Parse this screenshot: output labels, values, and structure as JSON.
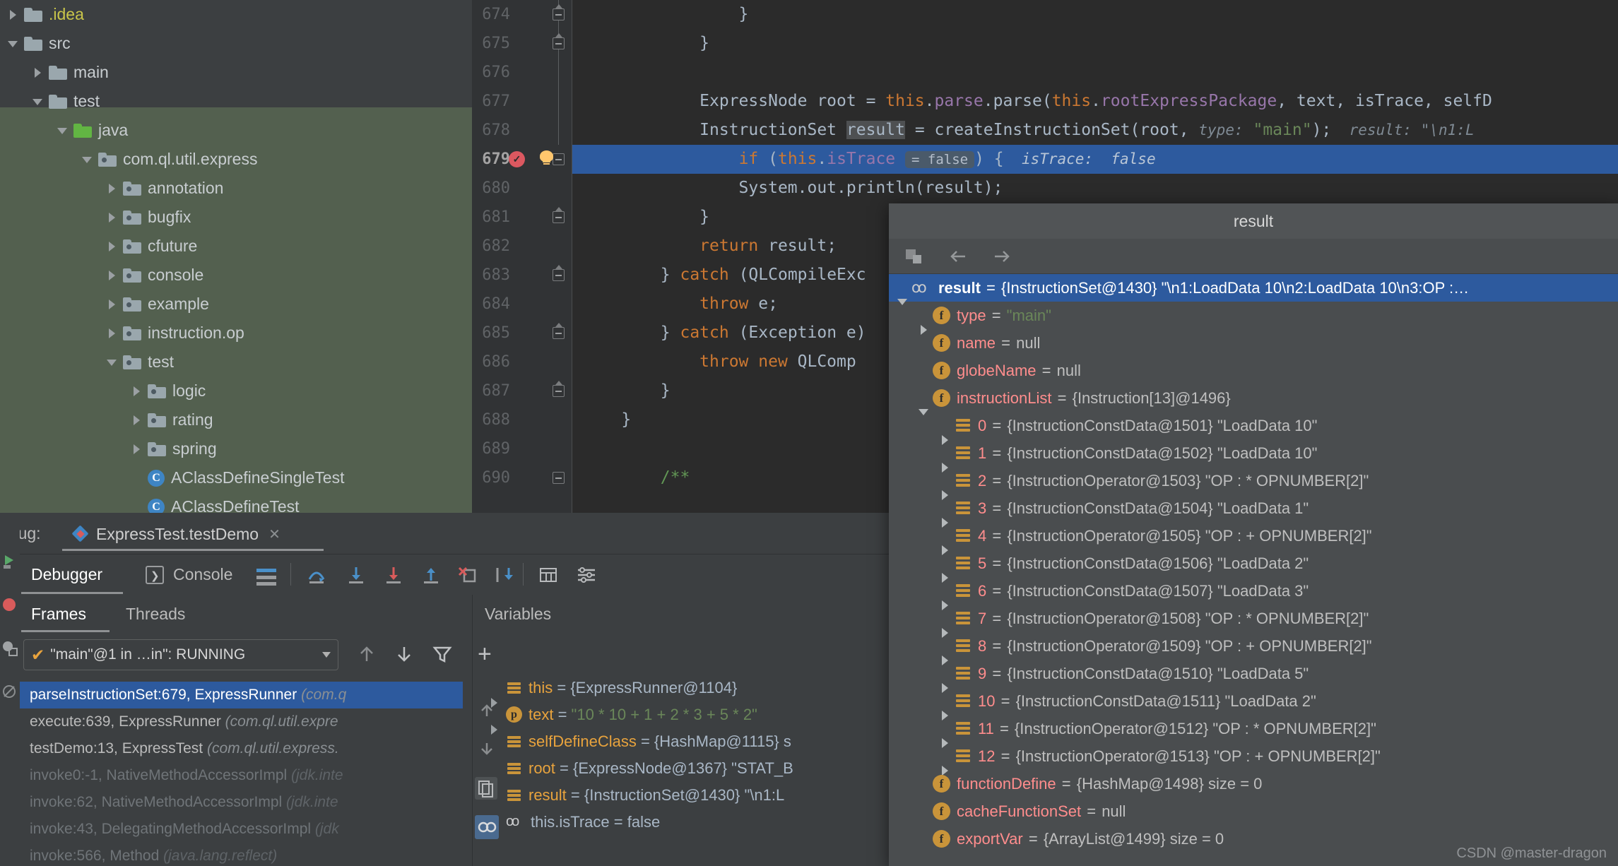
{
  "project_tree": [
    {
      "label": ".idea",
      "indent": 0,
      "twisty": "closed",
      "icon": "folder",
      "color": "yellow"
    },
    {
      "label": "src",
      "indent": 0,
      "twisty": "open",
      "icon": "folder",
      "color": "normal"
    },
    {
      "label": "main",
      "indent": 1,
      "twisty": "closed",
      "icon": "folder",
      "color": "normal"
    },
    {
      "label": "test",
      "indent": 1,
      "twisty": "open",
      "icon": "folder",
      "color": "normal"
    },
    {
      "label": "java",
      "indent": 2,
      "twisty": "open",
      "icon": "folder-green",
      "color": "normal"
    },
    {
      "label": "com.ql.util.express",
      "indent": 3,
      "twisty": "open",
      "icon": "package",
      "color": "normal"
    },
    {
      "label": "annotation",
      "indent": 4,
      "twisty": "closed",
      "icon": "package",
      "color": "normal"
    },
    {
      "label": "bugfix",
      "indent": 4,
      "twisty": "closed",
      "icon": "package",
      "color": "normal"
    },
    {
      "label": "cfuture",
      "indent": 4,
      "twisty": "closed",
      "icon": "package",
      "color": "normal"
    },
    {
      "label": "console",
      "indent": 4,
      "twisty": "closed",
      "icon": "package",
      "color": "normal"
    },
    {
      "label": "example",
      "indent": 4,
      "twisty": "closed",
      "icon": "package",
      "color": "normal"
    },
    {
      "label": "instruction.op",
      "indent": 4,
      "twisty": "closed",
      "icon": "package",
      "color": "normal"
    },
    {
      "label": "test",
      "indent": 4,
      "twisty": "open",
      "icon": "package",
      "color": "normal"
    },
    {
      "label": "logic",
      "indent": 5,
      "twisty": "closed",
      "icon": "package",
      "color": "normal"
    },
    {
      "label": "rating",
      "indent": 5,
      "twisty": "closed",
      "icon": "package",
      "color": "normal"
    },
    {
      "label": "spring",
      "indent": 5,
      "twisty": "closed",
      "icon": "package",
      "color": "normal"
    },
    {
      "label": "AClassDefineSingleTest",
      "indent": 5,
      "twisty": "none",
      "icon": "class",
      "color": "normal"
    },
    {
      "label": "AClassDefineTest",
      "indent": 5,
      "twisty": "none",
      "icon": "class",
      "color": "normal"
    }
  ],
  "editor": {
    "lines": [
      {
        "num": "674",
        "fold": "up",
        "foldline": true,
        "current": false,
        "breakpoint": false,
        "bulb": false
      },
      {
        "num": "675",
        "fold": "up",
        "foldline": true,
        "current": false,
        "breakpoint": false,
        "bulb": false
      },
      {
        "num": "676",
        "fold": "none",
        "foldline": true,
        "current": false,
        "breakpoint": false,
        "bulb": false
      },
      {
        "num": "677",
        "fold": "none",
        "foldline": true,
        "current": false,
        "breakpoint": false,
        "bulb": false
      },
      {
        "num": "678",
        "fold": "none",
        "foldline": true,
        "current": false,
        "breakpoint": false,
        "bulb": false
      },
      {
        "num": "679",
        "fold": "plain",
        "foldline": false,
        "current": true,
        "breakpoint": true,
        "bulb": true
      },
      {
        "num": "680",
        "fold": "none",
        "foldline": false,
        "current": false,
        "breakpoint": false,
        "bulb": false
      },
      {
        "num": "681",
        "fold": "up",
        "foldline": false,
        "current": false,
        "breakpoint": false,
        "bulb": false
      },
      {
        "num": "682",
        "fold": "none",
        "foldline": false,
        "current": false,
        "breakpoint": false,
        "bulb": false
      },
      {
        "num": "683",
        "fold": "up",
        "foldline": false,
        "current": false,
        "breakpoint": false,
        "bulb": false
      },
      {
        "num": "684",
        "fold": "none",
        "foldline": false,
        "current": false,
        "breakpoint": false,
        "bulb": false
      },
      {
        "num": "685",
        "fold": "up",
        "foldline": false,
        "current": false,
        "breakpoint": false,
        "bulb": false
      },
      {
        "num": "686",
        "fold": "none",
        "foldline": false,
        "current": false,
        "breakpoint": false,
        "bulb": false
      },
      {
        "num": "687",
        "fold": "up",
        "foldline": false,
        "current": false,
        "breakpoint": false,
        "bulb": false
      },
      {
        "num": "688",
        "fold": "none",
        "foldline": false,
        "current": false,
        "breakpoint": false,
        "bulb": false
      },
      {
        "num": "689",
        "fold": "none",
        "foldline": false,
        "current": false,
        "breakpoint": false,
        "bulb": false
      },
      {
        "num": "690",
        "fold": "plain",
        "foldline": false,
        "current": false,
        "breakpoint": false,
        "bulb": false
      }
    ],
    "code_text": {
      "l674": "                }",
      "l675": "            }",
      "l676": "",
      "l677_a": "            ExpressNode root = ",
      "l677_this": "this",
      "l677_b": ".",
      "l677_parse": "parse",
      "l677_c": ".parse(",
      "l677_this2": "this",
      "l677_d": ".",
      "l677_field": "rootExpressPackage",
      "l677_e": ", text, isTrace, selfD",
      "l678_a": "            InstructionSet ",
      "l678_sel": "result",
      "l678_b": " = createInstructionSet(root, ",
      "l678_hint": "type:",
      "l678_str": "\"main\"",
      "l678_c": ");",
      "l678_hint2": "result:",
      "l678_hint2val": "\"\\n1:L",
      "l679_if": "if",
      "l679_a": " (",
      "l679_this": "this",
      "l679_dot": ".",
      "l679_field": "isTrace",
      "l679_badge": "= false",
      "l679_b": ") {",
      "l679_hint": "isTrace:  false",
      "l680": "                System.out.println(result);",
      "l681": "            }",
      "l682_ret": "return",
      "l682_rest": " result;",
      "l683_a": "        } ",
      "l683_catch": "catch",
      "l683_b": " (QLCompileExc",
      "l684_throw": "throw",
      "l684_rest": " e;",
      "l685_a": "        } ",
      "l685_catch": "catch",
      "l685_b": " (Exception e)",
      "l686_throw": "throw new",
      "l686_rest": " QLComp",
      "l687": "        }",
      "l688": "    }",
      "l689": "",
      "l690_comment": "/**"
    }
  },
  "debug_window": {
    "title": "ebug:",
    "run_config": "ExpressTest.testDemo",
    "tabs": [
      {
        "label": "Debugger",
        "selected": true
      },
      {
        "label": "Console",
        "selected": false
      }
    ],
    "frames_tabs": [
      {
        "label": "Frames",
        "selected": true
      },
      {
        "label": "Threads",
        "selected": false
      }
    ],
    "thread_selector": "\"main\"@1 in …in\": RUNNING",
    "frames": [
      {
        "method": "parseInstructionSet:679, ExpressRunner",
        "loc": "(com.q",
        "selected": true,
        "dim": false
      },
      {
        "method": "execute:639, ExpressRunner",
        "loc": "(com.ql.util.expre",
        "selected": false,
        "dim": false
      },
      {
        "method": "testDemo:13, ExpressTest",
        "loc": "(com.ql.util.express.",
        "selected": false,
        "dim": false
      },
      {
        "method": "invoke0:-1, NativeMethodAccessorImpl",
        "loc": "(jdk.inte",
        "selected": false,
        "dim": true
      },
      {
        "method": "invoke:62, NativeMethodAccessorImpl",
        "loc": "(jdk.inte",
        "selected": false,
        "dim": true
      },
      {
        "method": "invoke:43, DelegatingMethodAccessorImpl",
        "loc": "(jdk",
        "selected": false,
        "dim": true
      },
      {
        "method": "invoke:566, Method",
        "loc": "(java.lang.reflect)",
        "selected": false,
        "dim": true
      }
    ],
    "variables_title": "Variables",
    "variables": [
      {
        "twisty": "closed",
        "icon": "list",
        "name": "this",
        "eq": "=",
        "value": "{ExpressRunner@1104}",
        "value_kind": "plain"
      },
      {
        "twisty": "closed",
        "icon": "param",
        "name": "text",
        "eq": "=",
        "value": "\"10 * 10 + 1 + 2 * 3 + 5 * 2\"",
        "value_kind": "str"
      },
      {
        "twisty": "none",
        "icon": "list",
        "name": "selfDefineClass",
        "eq": "=",
        "value": "{HashMap@1115}  s",
        "value_kind": "plain"
      },
      {
        "twisty": "closed",
        "icon": "list",
        "name": "root",
        "eq": "=",
        "value": "{ExpressNode@1367} \"STAT_B",
        "value_kind": "plain"
      },
      {
        "twisty": "none",
        "icon": "list",
        "name": "result",
        "eq": "=",
        "value": "{InstructionSet@1430} \"\\n1:L",
        "value_kind": "plain"
      },
      {
        "twisty": "none",
        "icon": "infinity",
        "name": "this.isTrace",
        "eq": "=",
        "value": "false",
        "value_kind": "plain"
      }
    ]
  },
  "popup": {
    "title": "result",
    "rows": [
      {
        "indent": 0,
        "twisty": "open",
        "icon": "infinity",
        "name": "result",
        "eq": "=",
        "value": "{InstructionSet@1430} \"\\n1:LoadData 10\\n2:LoadData 10\\n3:OP :…",
        "selected": true,
        "kind": "plain"
      },
      {
        "indent": 1,
        "twisty": "closed",
        "icon": "field",
        "name": "type",
        "eq": "=",
        "value": "\"main\"",
        "selected": false,
        "kind": "str"
      },
      {
        "indent": 1,
        "twisty": "none",
        "icon": "field",
        "name": "name",
        "eq": "=",
        "value": "null",
        "selected": false,
        "kind": "plain"
      },
      {
        "indent": 1,
        "twisty": "none",
        "icon": "field",
        "name": "globeName",
        "eq": "=",
        "value": "null",
        "selected": false,
        "kind": "plain"
      },
      {
        "indent": 1,
        "twisty": "open",
        "icon": "field",
        "name": "instructionList",
        "eq": "=",
        "value": "{Instruction[13]@1496}",
        "selected": false,
        "kind": "plain"
      },
      {
        "indent": 2,
        "twisty": "closed",
        "icon": "array",
        "name": "0",
        "eq": "=",
        "value": "{InstructionConstData@1501} \"LoadData 10\"",
        "selected": false,
        "kind": "plain"
      },
      {
        "indent": 2,
        "twisty": "closed",
        "icon": "array",
        "name": "1",
        "eq": "=",
        "value": "{InstructionConstData@1502} \"LoadData 10\"",
        "selected": false,
        "kind": "plain"
      },
      {
        "indent": 2,
        "twisty": "closed",
        "icon": "array",
        "name": "2",
        "eq": "=",
        "value": "{InstructionOperator@1503} \"OP : * OPNUMBER[2]\"",
        "selected": false,
        "kind": "plain"
      },
      {
        "indent": 2,
        "twisty": "closed",
        "icon": "array",
        "name": "3",
        "eq": "=",
        "value": "{InstructionConstData@1504} \"LoadData 1\"",
        "selected": false,
        "kind": "plain"
      },
      {
        "indent": 2,
        "twisty": "closed",
        "icon": "array",
        "name": "4",
        "eq": "=",
        "value": "{InstructionOperator@1505} \"OP : + OPNUMBER[2]\"",
        "selected": false,
        "kind": "plain"
      },
      {
        "indent": 2,
        "twisty": "closed",
        "icon": "array",
        "name": "5",
        "eq": "=",
        "value": "{InstructionConstData@1506} \"LoadData 2\"",
        "selected": false,
        "kind": "plain"
      },
      {
        "indent": 2,
        "twisty": "closed",
        "icon": "array",
        "name": "6",
        "eq": "=",
        "value": "{InstructionConstData@1507} \"LoadData 3\"",
        "selected": false,
        "kind": "plain"
      },
      {
        "indent": 2,
        "twisty": "closed",
        "icon": "array",
        "name": "7",
        "eq": "=",
        "value": "{InstructionOperator@1508} \"OP : * OPNUMBER[2]\"",
        "selected": false,
        "kind": "plain"
      },
      {
        "indent": 2,
        "twisty": "closed",
        "icon": "array",
        "name": "8",
        "eq": "=",
        "value": "{InstructionOperator@1509} \"OP : + OPNUMBER[2]\"",
        "selected": false,
        "kind": "plain"
      },
      {
        "indent": 2,
        "twisty": "closed",
        "icon": "array",
        "name": "9",
        "eq": "=",
        "value": "{InstructionConstData@1510} \"LoadData 5\"",
        "selected": false,
        "kind": "plain"
      },
      {
        "indent": 2,
        "twisty": "closed",
        "icon": "array",
        "name": "10",
        "eq": "=",
        "value": "{InstructionConstData@1511} \"LoadData 2\"",
        "selected": false,
        "kind": "plain"
      },
      {
        "indent": 2,
        "twisty": "closed",
        "icon": "array",
        "name": "11",
        "eq": "=",
        "value": "{InstructionOperator@1512} \"OP : * OPNUMBER[2]\"",
        "selected": false,
        "kind": "plain"
      },
      {
        "indent": 2,
        "twisty": "closed",
        "icon": "array",
        "name": "12",
        "eq": "=",
        "value": "{InstructionOperator@1513} \"OP : + OPNUMBER[2]\"",
        "selected": false,
        "kind": "plain"
      },
      {
        "indent": 1,
        "twisty": "none",
        "icon": "field",
        "name": "functionDefine",
        "eq": "=",
        "value": "{HashMap@1498}  size = 0",
        "selected": false,
        "kind": "plain"
      },
      {
        "indent": 1,
        "twisty": "none",
        "icon": "field",
        "name": "cacheFunctionSet",
        "eq": "=",
        "value": "null",
        "selected": false,
        "kind": "plain"
      },
      {
        "indent": 1,
        "twisty": "none",
        "icon": "field",
        "name": "exportVar",
        "eq": "=",
        "value": "{ArrayList@1499}  size = 0",
        "selected": false,
        "kind": "plain"
      }
    ]
  },
  "watermark": "CSDN @master-dragon"
}
